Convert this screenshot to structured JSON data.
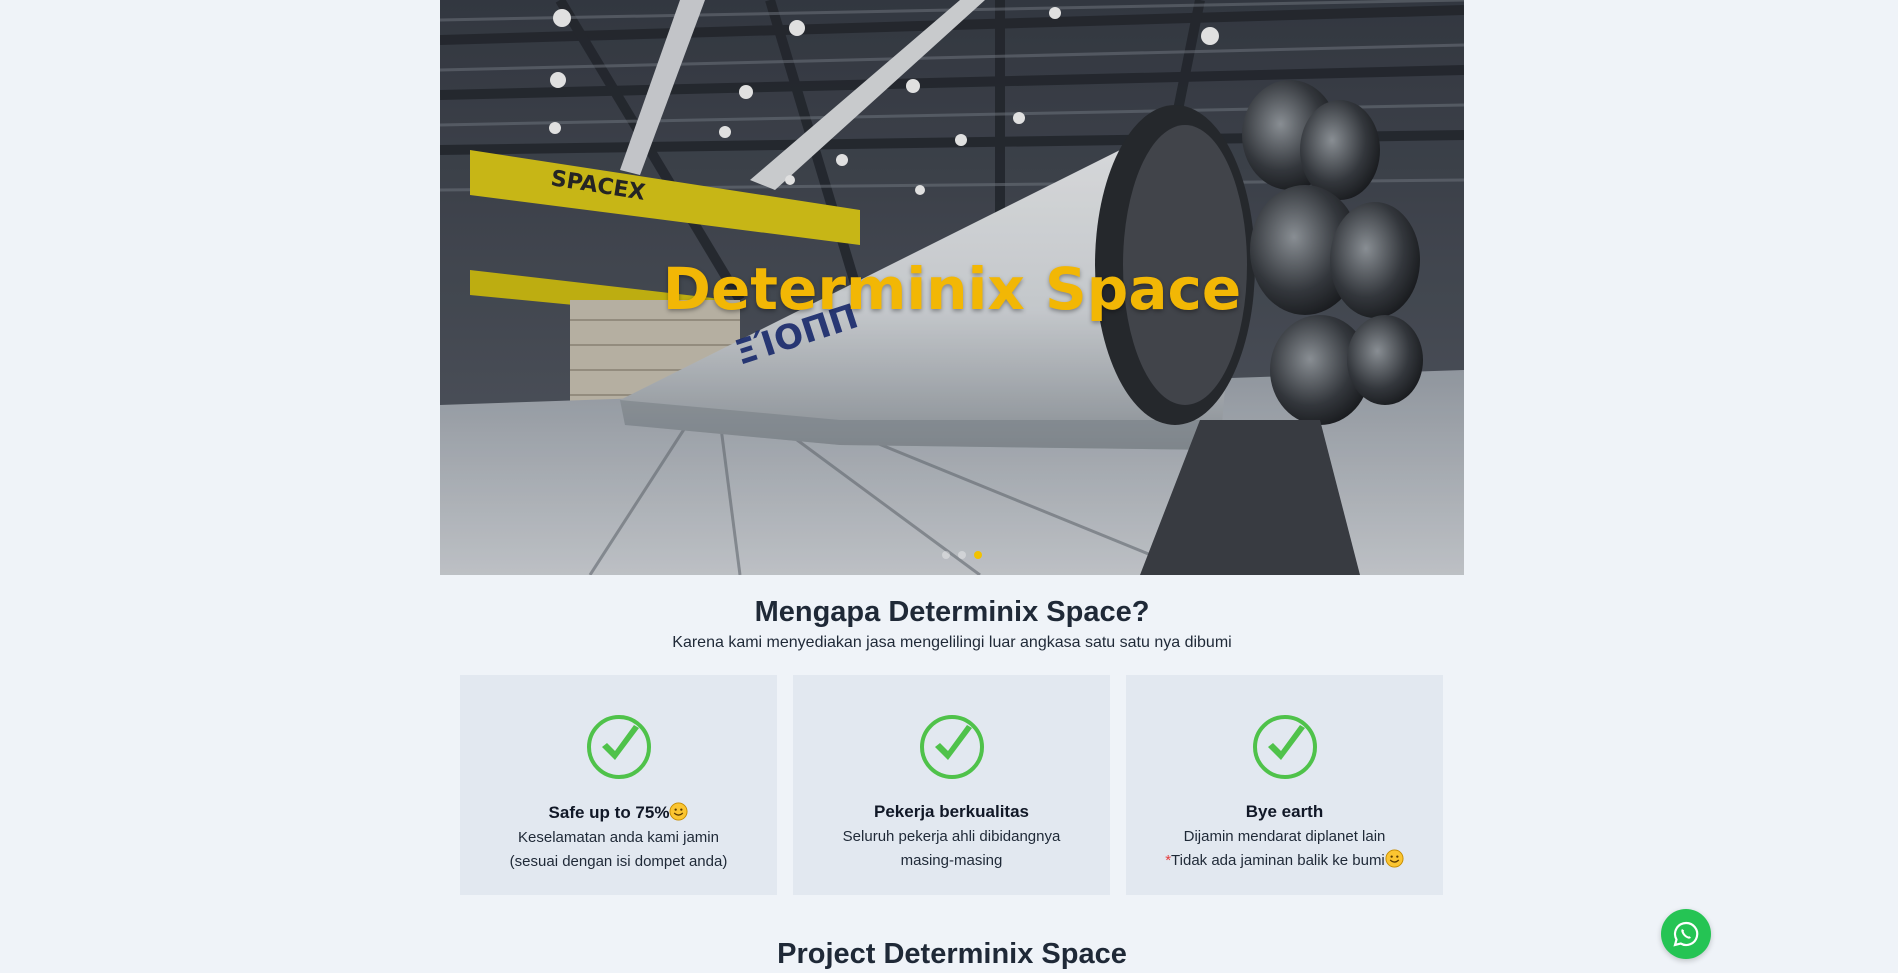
{
  "hero": {
    "title": "Determinix Space",
    "hangar_crane_text": "SPACEX",
    "slides": 3,
    "active_slide": 3,
    "accent_color": "#f2b705"
  },
  "why": {
    "heading": "Mengapa Determinix Space?",
    "subtitle": "Karena kami menyediakan jasa mengelilingi luar angkasa satu satu nya dibumi",
    "cards": [
      {
        "icon": "check-circle-icon",
        "title": "Safe up to 75%",
        "lines": [
          "Keselamatan anda kami jamin",
          "(sesuai dengan isi dompet anda)"
        ]
      },
      {
        "icon": "check-circle-icon",
        "title": "Pekerja berkualitas",
        "lines": [
          "Seluruh pekerja ahli dibidangnya",
          "masing-masing"
        ]
      },
      {
        "icon": "check-circle-icon",
        "title": "Bye earth",
        "lines": [
          "Dijamin mendarat diplanet lain",
          "Tidak ada jaminan balik ke bumi"
        ],
        "footnote_mark": "*"
      }
    ]
  },
  "projects": {
    "heading": "Project Determinix Space"
  },
  "whatsapp": {
    "icon": "whatsapp-icon",
    "color": "#25c454"
  }
}
